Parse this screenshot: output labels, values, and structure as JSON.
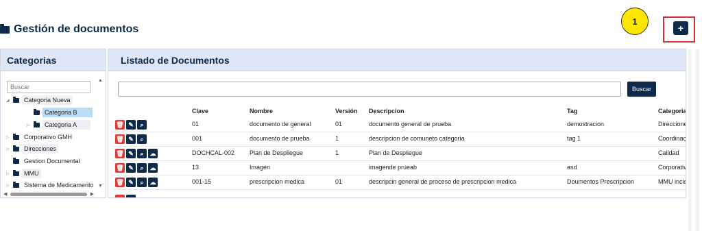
{
  "header": {
    "title": "Gestión de documentos",
    "step_number": "1",
    "add_label": "+"
  },
  "categories": {
    "title": "Categorias",
    "search_placeholder": "Buscar",
    "items": [
      {
        "label": "Categoria Nueva",
        "arrow": "◢"
      },
      {
        "label": "Categoria B",
        "arrow": ""
      },
      {
        "label": "Categoria A",
        "arrow": "▷"
      },
      {
        "label": "Corporativo GMH",
        "arrow": "▷"
      },
      {
        "label": "Direcciones",
        "arrow": "▷"
      },
      {
        "label": "Gestion Documental",
        "arrow": ""
      },
      {
        "label": "MMU",
        "arrow": "▷"
      },
      {
        "label": "Sistema de Medicamento",
        "arrow": "▷"
      }
    ]
  },
  "documents": {
    "title": "Listado de Documentos",
    "search_button": "Buscar",
    "columns": [
      "Clave",
      "Nombre",
      "Versión",
      "Descripcion",
      "Tag",
      "Categoria"
    ],
    "rows": [
      {
        "clave": "01",
        "nombre": "documento de general",
        "version": "01",
        "descripcion": "documento general de prueba",
        "tag": "demostracion",
        "categoria": "Direccione",
        "upload": false
      },
      {
        "clave": "001",
        "nombre": "documento de prueba",
        "version": "1",
        "descripcion": "descripcion de comuneto categoria",
        "tag": "tag 1",
        "categoria": "Coordinaci",
        "upload": false
      },
      {
        "clave": "DOCHCAL-002",
        "nombre": "Plan de Despliegue",
        "version": "1",
        "descripcion": "Plan de Despliegue",
        "tag": "",
        "categoria": "Calidad",
        "upload": true
      },
      {
        "clave": "13",
        "nombre": "Imagen",
        "version": "",
        "descripcion": "imagende prueab",
        "tag": "asd",
        "categoria": "Corporativ",
        "upload": true
      },
      {
        "clave": "001-15",
        "nombre": "prescripcion medica",
        "version": "01",
        "descripcion": "descripcin general de proceso de prescripcion medica",
        "tag": "Doumentos Prescripcion",
        "categoria": "MMU incis",
        "upload": true
      }
    ],
    "action_icons": {
      "delete": "trash-icon",
      "edit": "pencil-icon",
      "view": "search-icon",
      "upload": "cloud-upload-icon"
    }
  }
}
